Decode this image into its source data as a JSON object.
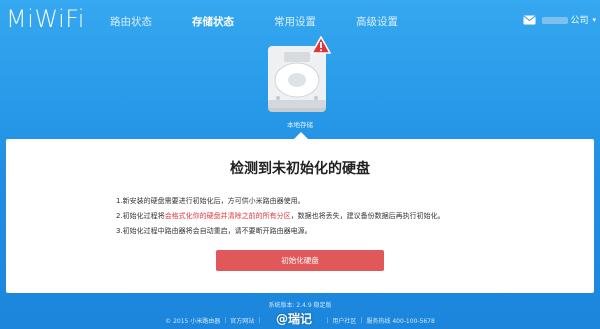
{
  "brand": {
    "logo_text": "MiWiFi"
  },
  "nav": {
    "items": [
      {
        "label": "路由状态"
      },
      {
        "label": "存储状态"
      },
      {
        "label": "常用设置"
      },
      {
        "label": "高级设置"
      }
    ],
    "active_index": 1
  },
  "user": {
    "name_suffix": "公司",
    "caret": "▾"
  },
  "disk": {
    "label": "本地存储",
    "status": "warning"
  },
  "dialog": {
    "title": "检测到未初始化的硬盘",
    "notes": [
      {
        "text": "1.新安装的硬盘需要进行初始化后，方可供小米路由器使用。"
      },
      {
        "prefix": "2.初始化过程将",
        "warning": "会格式化你的硬盘并清除之前的所有分区",
        "suffix": "，数据也将丢失，建议备份数据后再执行初始化。"
      },
      {
        "text": "3.初始化过程中路由器将会自动重启，请不要断开路由器电源。"
      }
    ],
    "button_label": "初始化硬盘"
  },
  "footer": {
    "version": "系统版本: 2.4.9 稳定版",
    "copyright": "© 2015 小米路由器",
    "link_official": "官方网站",
    "link_community": "用户社区",
    "hotline": "服务热线 400-100-5678"
  },
  "watermark": "@瑞记",
  "colors": {
    "background": "#2a9be8",
    "warning_text": "#e0363b",
    "button": "#e0585a"
  }
}
